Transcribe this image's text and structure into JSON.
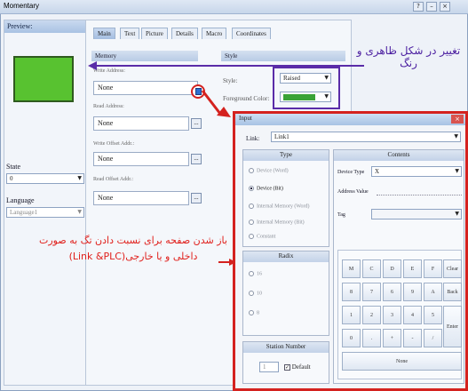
{
  "window": {
    "title": "Momentary"
  },
  "left": {
    "preview_label": "Preview:",
    "state_label": "State",
    "state_value": "0",
    "language_label": "Language",
    "language_value": "Language1"
  },
  "tabs": [
    {
      "label": "Main"
    },
    {
      "label": "Text"
    },
    {
      "label": "Picture"
    },
    {
      "label": "Details"
    },
    {
      "label": "Macro"
    },
    {
      "label": "Coordinates"
    }
  ],
  "sections": {
    "memory": "Memory",
    "style": "Style"
  },
  "memory": {
    "write_address_label": "Write Address:",
    "write_address_value": "None",
    "read_address_label": "Read Address:",
    "read_address_value": "None",
    "write_offset_label": "Write Offset Addr.:",
    "write_offset_value": "None",
    "read_offset_label": "Read Offset Addr.:",
    "read_offset_value": "None",
    "browse": "..."
  },
  "style": {
    "style_label": "Style:",
    "style_value": "Raised",
    "fg_color_label": "Foreground Color:",
    "fg_color": "#3aa336"
  },
  "dialog": {
    "title": "Input",
    "link_label": "Link:",
    "link_value": "Link1",
    "type_header": "Type",
    "type_options": [
      {
        "label": "Device (Word)",
        "selected": false
      },
      {
        "label": "Device (Bit)",
        "selected": true
      },
      {
        "label": "Internal Memory (Word)",
        "selected": false
      },
      {
        "label": "Internal Memory (Bit)",
        "selected": false
      },
      {
        "label": "Constant",
        "selected": false
      }
    ],
    "radix_header": "Radix",
    "radix_options": [
      "16",
      "10",
      "8"
    ],
    "station_header": "Station Number",
    "station_value": "1",
    "default_label": "Default",
    "contents_header": "Contents",
    "device_type_label": "Device Type",
    "device_type_value": "X",
    "address_value_label": "Address Value",
    "tag_label": "Tag",
    "keypad_rows": [
      [
        "M",
        "C",
        "D",
        "E",
        "F",
        "Clear"
      ],
      [
        "8",
        "7",
        "6",
        "9",
        "A",
        "Back"
      ],
      [
        "1",
        "2",
        "3",
        "4",
        "5",
        ""
      ],
      [
        "0",
        ".",
        "+",
        "-",
        "/",
        ""
      ]
    ],
    "enter_label": "Enter",
    "none_label": "None"
  },
  "annotations": {
    "purple": "تغییر در شکل ظاهری و رنگ",
    "red": "باز شدن صفحه برای نسبت دادن تگ به صورت داخلی و یا خارجی(Link &PLC)"
  },
  "colors": {
    "accent_purple": "#5a2ca8",
    "accent_red": "#d4221f",
    "preview_green": "#58c230"
  }
}
